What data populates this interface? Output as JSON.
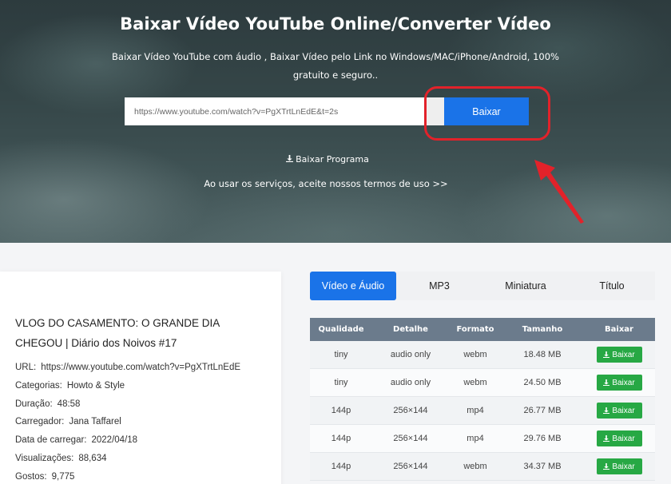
{
  "hero": {
    "title": "Baixar Vídeo YouTube Online/Converter Vídeo",
    "subtitle": "Baixar Vídeo YouTube com áudio , Baixar Vídeo pelo Link no Windows/MAC/iPhone/Android, 100% gratuito e seguro..",
    "url_value": "https://www.youtube.com/watch?v=PgXTrtLnEdE&t=2s",
    "download_button": "Baixar",
    "program_link": "Baixar Programa",
    "terms": "Ao usar os serviços, aceite nossos termos de uso >>"
  },
  "video": {
    "title": "VLOG DO CASAMENTO: O GRANDE DIA CHEGOU | Diário dos Noivos #17",
    "meta": [
      {
        "label": "URL:",
        "value": "https://www.youtube.com/watch?v=PgXTrtLnEdE"
      },
      {
        "label": "Categorias:",
        "value": "Howto & Style"
      },
      {
        "label": "Duração:",
        "value": "48:58"
      },
      {
        "label": "Carregador:",
        "value": "Jana Taffarel"
      },
      {
        "label": "Data de carregar:",
        "value": "2022/04/18"
      },
      {
        "label": "Visualizações:",
        "value": "88,634"
      },
      {
        "label": "Gostos:",
        "value": "9,775"
      }
    ]
  },
  "tabs": [
    {
      "label": "Vídeo e Áudio",
      "active": true
    },
    {
      "label": "MP3",
      "active": false
    },
    {
      "label": "Miniatura",
      "active": false
    },
    {
      "label": "Título",
      "active": false
    }
  ],
  "table": {
    "headers": [
      "Qualidade",
      "Detalhe",
      "Formato",
      "Tamanho",
      "Baixar"
    ],
    "rows": [
      {
        "quality": "tiny",
        "detail": "audio only",
        "format": "webm",
        "size": "18.48 MB",
        "action": "Baixar"
      },
      {
        "quality": "tiny",
        "detail": "audio only",
        "format": "webm",
        "size": "24.50 MB",
        "action": "Baixar"
      },
      {
        "quality": "144p",
        "detail": "256×144",
        "format": "mp4",
        "size": "26.77 MB",
        "action": "Baixar"
      },
      {
        "quality": "144p",
        "detail": "256×144",
        "format": "mp4",
        "size": "29.76 MB",
        "action": "Baixar"
      },
      {
        "quality": "144p",
        "detail": "256×144",
        "format": "webm",
        "size": "34.37 MB",
        "action": "Baixar"
      }
    ]
  },
  "colors": {
    "primary": "#1a73e8",
    "download_green": "#27a844",
    "highlight_red": "#e2222a",
    "table_header": "#6b7b8c"
  }
}
